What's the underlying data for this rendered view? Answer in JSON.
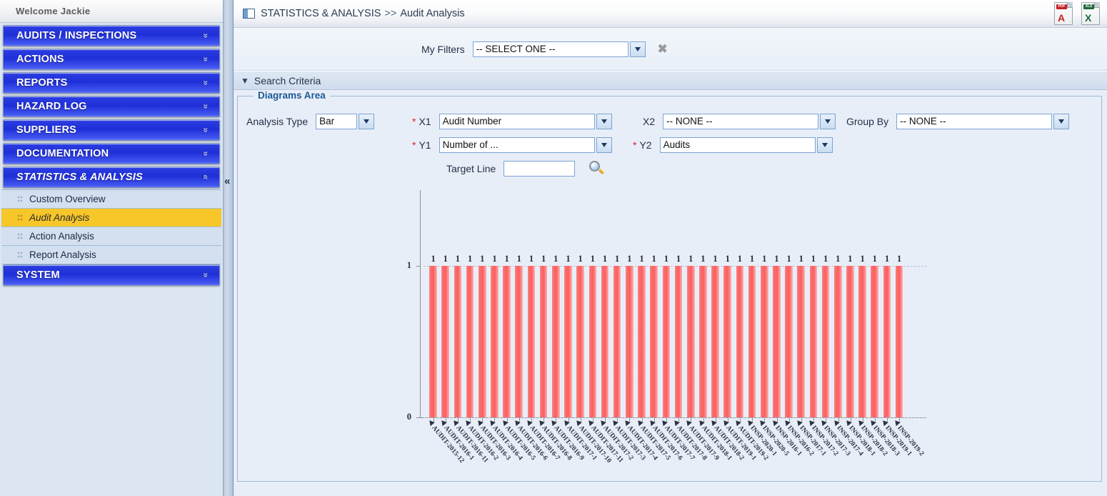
{
  "sidebar": {
    "welcome": "Welcome  Jackie",
    "groups": [
      {
        "label": "AUDITS / INSPECTIONS",
        "expanded": false,
        "chevron": "chevron-double-down-icon"
      },
      {
        "label": "ACTIONS",
        "expanded": false,
        "chevron": "chevron-double-down-icon"
      },
      {
        "label": "REPORTS",
        "expanded": false,
        "chevron": "chevron-double-down-icon"
      },
      {
        "label": "HAZARD LOG",
        "expanded": false,
        "chevron": "chevron-double-down-icon"
      },
      {
        "label": "SUPPLIERS",
        "expanded": false,
        "chevron": "chevron-double-down-icon"
      },
      {
        "label": "DOCUMENTATION",
        "expanded": false,
        "chevron": "chevron-double-down-icon"
      },
      {
        "label": "STATISTICS & ANALYSIS",
        "expanded": true,
        "chevron": "chevron-double-up-icon"
      },
      {
        "label": "SYSTEM",
        "expanded": false,
        "chevron": "chevron-double-down-icon"
      }
    ],
    "sub_items": [
      {
        "label": "Custom Overview",
        "selected": false
      },
      {
        "label": "Audit Analysis",
        "selected": true
      },
      {
        "label": "Action Analysis",
        "selected": false
      },
      {
        "label": "Report Analysis",
        "selected": false
      }
    ],
    "collapse_handle": "«"
  },
  "header": {
    "breadcrumb_root": "STATISTICS & ANALYSIS",
    "breadcrumb_sep": ">>",
    "breadcrumb_leaf": "Audit Analysis",
    "page_icon": "page-layout-icon",
    "export_pdf": {
      "label": "PDF",
      "glyph": "A",
      "icon": "pdf-export-icon"
    },
    "export_xls": {
      "label": "XLS",
      "glyph": "X",
      "icon": "excel-export-icon"
    }
  },
  "filters": {
    "label": "My Filters",
    "value": "-- SELECT ONE --",
    "delete_icon": "delete-filter-icon",
    "dropdown_icon": "chevron-down-icon"
  },
  "search_criteria": {
    "label": "Search Criteria",
    "toggle_icon": "chevron-double-down-icon"
  },
  "diagrams": {
    "legend": "Diagrams Area",
    "analysis_type": {
      "label": "Analysis Type",
      "value": "Bar"
    },
    "x1": {
      "label": "X1",
      "value": "Audit Number",
      "required": true,
      "req_mark": "*"
    },
    "y1": {
      "label": "Y1",
      "value": "Number of ...",
      "required": true,
      "req_mark": "*"
    },
    "x2": {
      "label": "X2",
      "value": "-- NONE --",
      "required": false
    },
    "y2": {
      "label": "Y2",
      "value": "Audits",
      "required": true,
      "req_mark": "*"
    },
    "group_by": {
      "label": "Group By",
      "value": "-- NONE --",
      "required": false
    },
    "target_line": {
      "label": "Target Line",
      "value": "",
      "placeholder": ""
    },
    "search_button": "search-magnifier-icon"
  },
  "chart_data": {
    "type": "bar",
    "title": "",
    "xlabel": "",
    "ylabel": "",
    "ylim": [
      0,
      1
    ],
    "yticks": [
      0,
      1
    ],
    "ytick_labels": [
      "0",
      "1"
    ],
    "grid": true,
    "legend_position": "none",
    "bar_color": "#fb7070",
    "categories": [
      "AUDIT-2015-12",
      "AUDIT-2016-1",
      "AUDIT-2016-11",
      "AUDIT-2016-2",
      "AUDIT-2016-3",
      "AUDIT-2016-4",
      "AUDIT-2016-5",
      "AUDIT-2016-6",
      "AUDIT-2016-7",
      "AUDIT-2016-8",
      "AUDIT-2016-9",
      "AUDIT-2017-1",
      "AUDIT-2017-10",
      "AUDIT-2017-11",
      "AUDIT-2017-2",
      "AUDIT-2017-3",
      "AUDIT-2017-4",
      "AUDIT-2017-5",
      "AUDIT-2017-6",
      "AUDIT-2017-7",
      "AUDIT-2017-8",
      "AUDIT-2017-9",
      "AUDIT-2018-1",
      "AUDIT-2018-2",
      "AUDIT-2019-1",
      "AUDIT-2019-2",
      "INSP-2020-1",
      "INSP-2020-5",
      "INSP-2016-1",
      "INSP-2016-2",
      "INSP-2017-1",
      "INSP-2017-2",
      "INSP-2017-3",
      "INSP-2017-4",
      "INSP-2018-1",
      "INSP-2018-2",
      "INSP-2018-3",
      "INSP-2019-1",
      "INSP-2019-2"
    ],
    "values": [
      1,
      1,
      1,
      1,
      1,
      1,
      1,
      1,
      1,
      1,
      1,
      1,
      1,
      1,
      1,
      1,
      1,
      1,
      1,
      1,
      1,
      1,
      1,
      1,
      1,
      1,
      1,
      1,
      1,
      1,
      1,
      1,
      1,
      1,
      1,
      1,
      1,
      1,
      1
    ],
    "value_labels": [
      "1",
      "1",
      "1",
      "1",
      "1",
      "1",
      "1",
      "1",
      "1",
      "1",
      "1",
      "1",
      "1",
      "1",
      "1",
      "1",
      "1",
      "1",
      "1",
      "1",
      "1",
      "1",
      "1",
      "1",
      "1",
      "1",
      "1",
      "1",
      "1",
      "1",
      "1",
      "1",
      "1",
      "1",
      "1",
      "1",
      "1",
      "1",
      "1"
    ],
    "series": [
      {
        "name": "Number of Audits",
        "values": [
          1,
          1,
          1,
          1,
          1,
          1,
          1,
          1,
          1,
          1,
          1,
          1,
          1,
          1,
          1,
          1,
          1,
          1,
          1,
          1,
          1,
          1,
          1,
          1,
          1,
          1,
          1,
          1,
          1,
          1,
          1,
          1,
          1,
          1,
          1,
          1,
          1,
          1,
          1
        ]
      }
    ]
  }
}
